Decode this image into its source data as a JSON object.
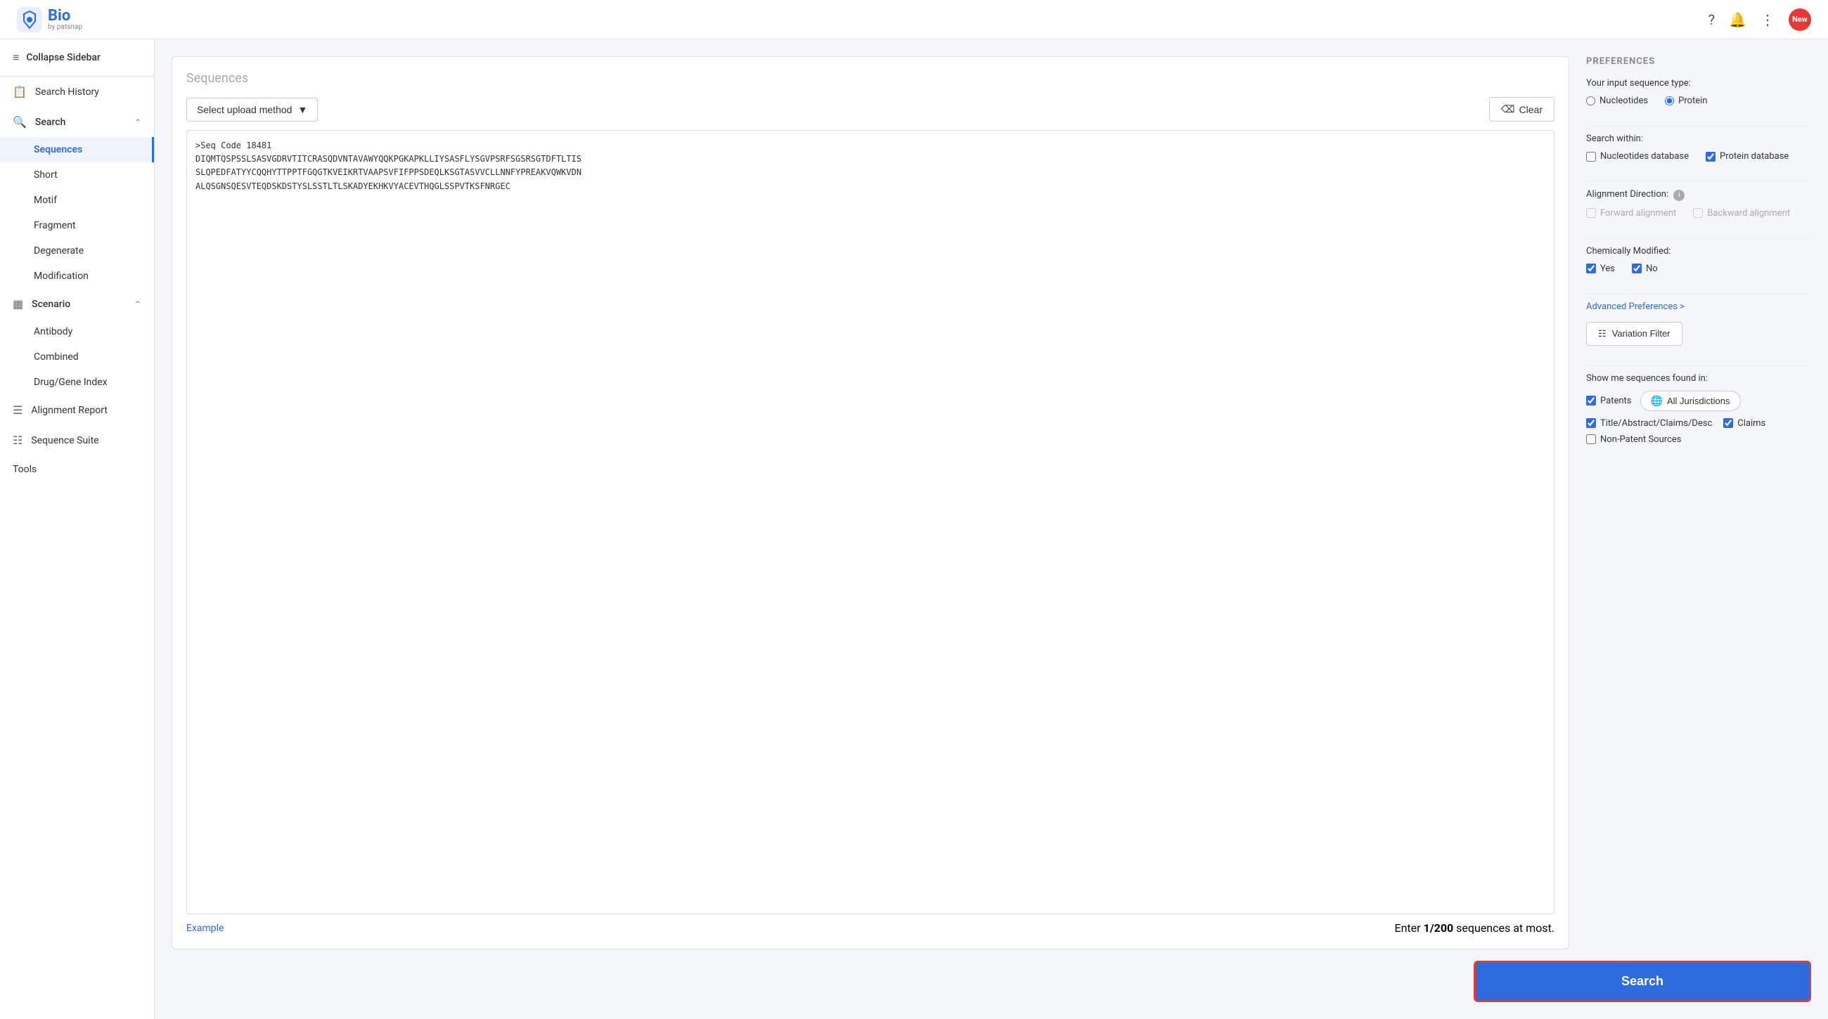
{
  "header": {
    "logo_bio": "Bio",
    "logo_sub": "by patsnap",
    "new_badge": "New"
  },
  "sidebar": {
    "collapse_label": "Collapse Sidebar",
    "search_history_label": "Search History",
    "search_group_label": "Search",
    "search_items": [
      {
        "id": "sequences",
        "label": "Sequences",
        "active": true
      },
      {
        "id": "short",
        "label": "Short"
      },
      {
        "id": "motif",
        "label": "Motif"
      },
      {
        "id": "fragment",
        "label": "Fragment"
      },
      {
        "id": "degenerate",
        "label": "Degenerate"
      },
      {
        "id": "modification",
        "label": "Modification"
      }
    ],
    "scenario_group_label": "Scenario",
    "scenario_items": [
      {
        "id": "antibody",
        "label": "Antibody"
      },
      {
        "id": "combined",
        "label": "Combined"
      },
      {
        "id": "drug_gene",
        "label": "Drug/Gene Index"
      }
    ],
    "alignment_report_label": "Alignment Report",
    "sequence_suite_label": "Sequence Suite",
    "tools_label": "Tools"
  },
  "sequences": {
    "title": "Sequences",
    "upload_method_placeholder": "Select upload method",
    "clear_button": "Clear",
    "sequence_text": ">Seq Code 18481\nDIQMTQSPSSLSASVGDRVTITCRASQDVNTAVAWYQQKPGKAPKLLIYSASFLYSGVPSRFSGSRSGTDFTLTIS\nSLQPEDFATYYCQQHYTTPPTFGQGTKVEIKRTVAAPSVFIFPPSDEQLKSGTASVVCLLNNFYPREAKVQWKVDN\nALQSGNSQESVTEQDSKDSTYSLSSTLTLSKADYEKHKVYACEVTHQGLSSPVTKSFNRGEC",
    "example_link": "Example",
    "seq_count_text": "Enter ",
    "seq_count_bold": "1/200",
    "seq_count_suffix": " sequences at most."
  },
  "preferences": {
    "title": "PREFERENCES",
    "input_sequence_type_label": "Your input sequence type:",
    "nucleotides_label": "Nucleotides",
    "protein_label": "Protein",
    "protein_selected": true,
    "search_within_label": "Search within:",
    "nucleotides_db_label": "Nucleotides database",
    "nucleotides_db_checked": false,
    "protein_db_label": "Protein database",
    "protein_db_checked": true,
    "alignment_direction_label": "Alignment Direction:",
    "forward_alignment_label": "Forward alignment",
    "backward_alignment_label": "Backward alignment",
    "chemically_modified_label": "Chemically Modified:",
    "yes_label": "Yes",
    "yes_checked": true,
    "no_label": "No",
    "no_checked": true,
    "advanced_preferences_link": "Advanced Preferences >",
    "variation_filter_label": "Variation Filter",
    "show_me_label": "Show me sequences found in:",
    "patents_label": "Patents",
    "patents_checked": true,
    "all_jurisdictions_label": "All Jurisdictions",
    "title_abstract_label": "Title/Abstract/Claims/Desc",
    "title_abstract_checked": true,
    "claims_label": "Claims",
    "claims_checked": true,
    "non_patent_label": "Non-Patent Sources",
    "non_patent_checked": false
  },
  "search_button": {
    "label": "Search"
  }
}
